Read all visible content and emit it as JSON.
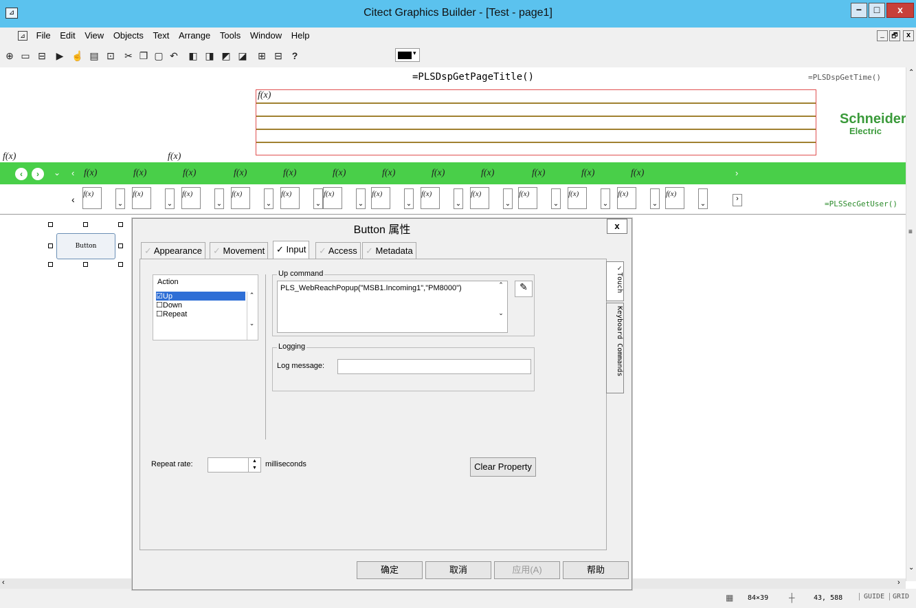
{
  "window": {
    "title": "Citect Graphics Builder - [Test - page1]",
    "minimize": "−",
    "restore": "□",
    "close": "x"
  },
  "menu": {
    "items": [
      "File",
      "Edit",
      "View",
      "Objects",
      "Text",
      "Arrange",
      "Tools",
      "Window",
      "Help"
    ]
  },
  "mdi": {
    "minimize": "_",
    "restore": "🗗",
    "close": "x"
  },
  "toolbar": {
    "help": "?"
  },
  "canvas": {
    "page_title_fn": "=PLSDspGetPageTitle()",
    "time_fn": "=PLSDspGetTime()",
    "user_fn": "=PLSSecGetUser()",
    "fx": "f(x)",
    "logo": "Schneider",
    "logo_sub": "Electric",
    "button_label": "Button"
  },
  "dialog": {
    "title": "Button 属性",
    "close": "x",
    "tabs": [
      {
        "label": "Appearance",
        "check": "✓"
      },
      {
        "label": "Movement",
        "check": "✓"
      },
      {
        "label": "Input",
        "check": "✓"
      },
      {
        "label": "Access",
        "check": "✓"
      },
      {
        "label": "Metadata",
        "check": "✓"
      }
    ],
    "side_tabs": [
      "✓Touch",
      "Keyboard Commands"
    ],
    "action_label": "Action",
    "actions": [
      {
        "label": "Up",
        "checked": true
      },
      {
        "label": "Down",
        "checked": false
      },
      {
        "label": "Repeat",
        "checked": false
      }
    ],
    "up_command_label": "Up command",
    "up_command_value": "PLS_WebReachPopup(\"MSB1.Incoming1\",\"PM8000\")",
    "logging_label": "Logging",
    "log_message_label": "Log message:",
    "log_message_value": "",
    "repeat_rate_label": "Repeat rate:",
    "repeat_rate_value": "",
    "milliseconds": "milliseconds",
    "clear_property": "Clear Property",
    "ok": "确定",
    "cancel": "取消",
    "apply": "应用(A)",
    "help": "帮助"
  },
  "status": {
    "size": "84×39",
    "position": "43, 588",
    "guide": "GUIDE",
    "grid": "GRID"
  }
}
